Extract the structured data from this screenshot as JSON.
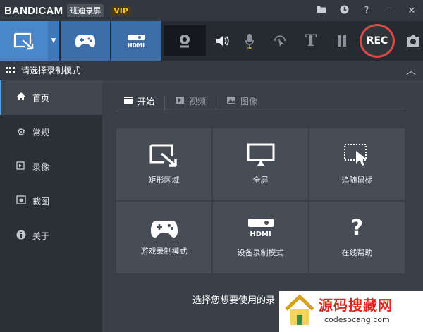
{
  "titlebar": {
    "logo": "BANDICAM",
    "app_title": "班迪录屏",
    "vip": "VIP",
    "icons": [
      "folder-icon",
      "clock-icon",
      "help-icon",
      "minimize-icon",
      "close-icon"
    ]
  },
  "toolbar": {
    "rec_label": "REC",
    "hdmi_label": "HDMI"
  },
  "section": {
    "title": "请选择录制模式"
  },
  "sidebar": {
    "items": [
      {
        "label": "首页",
        "icon": "home-icon"
      },
      {
        "label": "常规",
        "icon": "gear-icon"
      },
      {
        "label": "录像",
        "icon": "video-icon"
      },
      {
        "label": "截图",
        "icon": "camera-icon"
      },
      {
        "label": "关于",
        "icon": "info-icon"
      }
    ]
  },
  "tabs": [
    {
      "label": "开始",
      "icon": "clapper-icon"
    },
    {
      "label": "视频",
      "icon": "play-icon"
    },
    {
      "label": "图像",
      "icon": "image-icon"
    }
  ],
  "modes": [
    {
      "label": "矩形区域"
    },
    {
      "label": "全屏"
    },
    {
      "label": "追随鼠标"
    },
    {
      "label": "游戏录制模式"
    },
    {
      "label": "设备录制模式"
    },
    {
      "label": "在线帮助"
    }
  ],
  "prompt": "选择您想要使用的录",
  "watermark": {
    "text": "源码搜藏网",
    "url": "codesocang.com"
  }
}
